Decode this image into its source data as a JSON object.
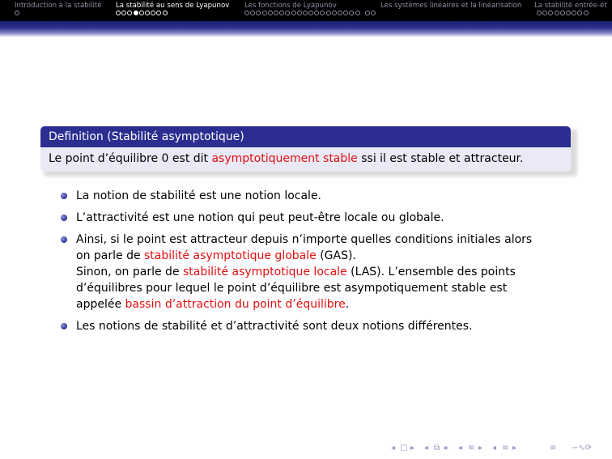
{
  "nav": {
    "sections": [
      {
        "label": "Introduction à la stabilité",
        "dots": [
          {
            "filled": false
          }
        ],
        "active": false
      },
      {
        "label": "La stabilité au sens de Lyapunov",
        "dots": [
          {
            "filled": false
          },
          {
            "filled": false
          },
          {
            "filled": false
          },
          {
            "filled": true
          },
          {
            "filled": false
          },
          {
            "filled": false
          },
          {
            "filled": false
          },
          {
            "filled": false
          },
          {
            "filled": false
          }
        ],
        "active": true
      },
      {
        "label": "Les fonctions de Lyapunov",
        "dots_count": 20,
        "extra_dots": 2,
        "active": false
      },
      {
        "label": "Les systèmes linéaires et la linéarisation",
        "active": false
      },
      {
        "label": "La stabilité entrée-ét",
        "dots_count": 9,
        "active": false
      }
    ]
  },
  "block": {
    "title": "Definition (Stabilité asymptotique)",
    "body_pre": "Le point d’équilibre 0 est dit ",
    "body_red": "asymptotiquement stable",
    "body_post": " ssi il est stable et attracteur."
  },
  "bullets": {
    "b1": "La notion de stabilité est une notion locale.",
    "b2": "L’attractivité est une notion qui peut peut-être locale ou globale.",
    "b3_line1": "Ainsi, si le point est attracteur depuis n’importe quelles conditions initiales alors",
    "b3_line2_pre": "on parle de ",
    "b3_line2_red": "stabilité asymptotique globale",
    "b3_line2_post": " (GAS).",
    "b3_line3_pre": "Sinon, on parle de ",
    "b3_line3_red": "stabilité asymptotique locale",
    "b3_line3_post": " (LAS). L’ensemble des points",
    "b3_line4": "d’équilibres pour lequel le point d’équilibre est asympotiquement stable est",
    "b3_line5_pre": "appelée ",
    "b3_line5_red": "bassin d’attraction du point d’équilibre",
    "b3_line5_post": ".",
    "b4": "Les notions de stabilité et d’attractivité sont deux notions différentes."
  },
  "footer_nav": {
    "frame_prev": "◂",
    "frame_icon": "□",
    "frame_next": "▸",
    "sub_prev": "◂",
    "sub_icon": "⧉",
    "sub_next": "▸",
    "sec_prev": "◂",
    "sec_icon": "≡",
    "sec_next": "▸",
    "ss_prev": "◂",
    "ss_icon": "≡",
    "ss_next": "▸",
    "doc_icon": "≡",
    "search_icon": "∽∿⟳"
  },
  "colors": {
    "nav_bg": "#000000",
    "block_title": "#2b2e90",
    "block_body": "#eaeaf6",
    "alert": "#e01010"
  }
}
